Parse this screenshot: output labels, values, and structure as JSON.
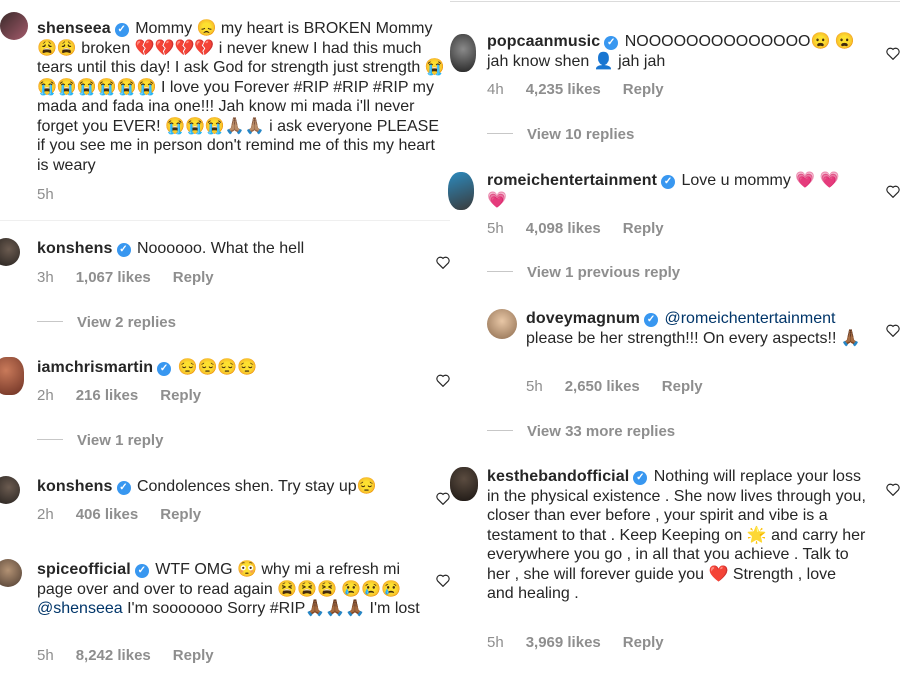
{
  "left": [
    {
      "user": "shenseea",
      "text": "Mommy 😞 my heart is BROKEN Mommy 😩😩 broken 💔💔💔💔 i never knew I had this much tears until this day! I ask God for strength just strength 😭😭😭😭😭😭😭 I love you Forever #RIP #RIP #RIP my mada and fada ina one!!! Jah know mi mada i'll never forget you EVER! 😭😭😭🙏🏽🙏🏽 i ask everyone PLEASE if you see me in person don't remind me of this my heart is weary",
      "time": "5h"
    },
    {
      "user": "konshens",
      "text": "Noooooo. What the hell",
      "time": "3h",
      "likes": "1,067 likes",
      "reply": "Reply",
      "view": "View 2 replies"
    },
    {
      "user": "iamchrismartin",
      "text": "😔😔😔😔",
      "time": "2h",
      "likes": "216 likes",
      "reply": "Reply",
      "view": "View 1 reply"
    },
    {
      "user": "konshens",
      "text": "Condolences shen. Try stay up😔",
      "time": "2h",
      "likes": "406 likes",
      "reply": "Reply"
    },
    {
      "user": "spiceofficial",
      "text": "WTF OMG 😳 why mi a refresh mi page over and over to read again 😫😫😫 😢😢😢",
      "mention": "@shenseea",
      "text2": "I'm sooooooo Sorry #RIP🙏🏾🙏🏾🙏🏾 I'm lost",
      "time": "5h",
      "likes": "8,242 likes",
      "reply": "Reply"
    }
  ],
  "right": [
    {
      "user": "popcaanmusic",
      "text": "NOOOOOOOOOOOOOO😦 😦 jah know shen 👤 jah jah",
      "time": "4h",
      "likes": "4,235 likes",
      "reply": "Reply",
      "view": "View 10 replies"
    },
    {
      "user": "romeichentertainment",
      "text": "Love u mommy 💗 💗💗",
      "time": "5h",
      "likes": "4,098 likes",
      "reply": "Reply",
      "view": "View 1 previous reply"
    },
    {
      "user": "doveymagnum",
      "mention": "@romeichentertainment",
      "text": "please be her strength!!! On every aspects!! 🙏🏾",
      "time": "5h",
      "likes": "2,650 likes",
      "reply": "Reply",
      "view": "View 33 more replies"
    },
    {
      "user": "kesthebandofficial",
      "text": "Nothing will replace your loss in the physical existence . She now lives through you, closer than ever before , your spirit and vibe is a testament to that . Keep Keeping on 🌟 and carry her everywhere you go , in all that you achieve . Talk to her , she will forever guide you ❤️ Strength , love and healing .",
      "time": "5h",
      "likes": "3,969 likes",
      "reply": "Reply"
    }
  ],
  "colors": {
    "verified": "#3897f0",
    "meta": "#8e8e8e",
    "link": "#003569"
  },
  "icons": {
    "verified": "verified-badge-icon",
    "like": "heart-outline-icon"
  }
}
